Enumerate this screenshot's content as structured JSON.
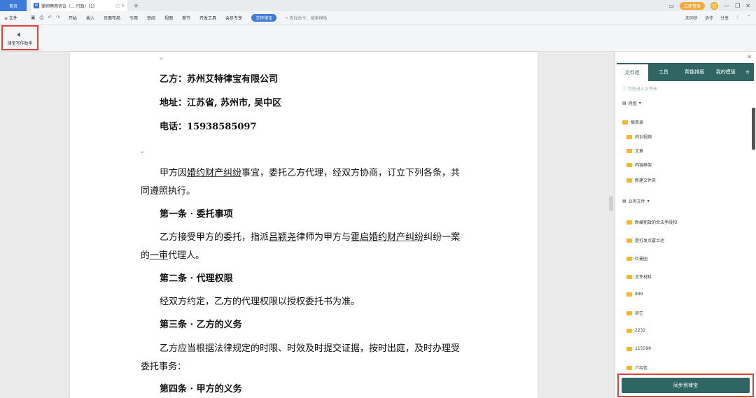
{
  "titlebar": {
    "home_tab": "首页",
    "doc_tab": "律师聘用协议（... 行政）(1)",
    "new_tab": "+",
    "login": "立即登录",
    "min": "—",
    "restore": "❐",
    "close": "✕"
  },
  "menubar": {
    "file": "≡ 文件",
    "items": [
      "开始",
      "插入",
      "页面布局",
      "引用",
      "审阅",
      "视图",
      "章节",
      "开发工具",
      "会员专享"
    ],
    "active": "艾特律宝",
    "search": "查找命令、搜索模板",
    "right": [
      "未同步",
      "协作",
      "分享"
    ]
  },
  "ribbon": {
    "assistant_label": "律宝写作助手"
  },
  "document": {
    "party_b": "乙方：苏州艾特律宝有限公司",
    "address": "地址：江苏省, 苏州市, 吴中区",
    "phone": "电话：15938585097",
    "intro_1a": "甲方因",
    "intro_1b": "婚约财产纠纷",
    "intro_1c": "事宜，委托乙方代理，经双方协商，订立下列各条，共",
    "intro_2": "同遵照执行。",
    "art1_title": "第一条 · 委托事项",
    "art1_1a": "乙方接受甲方的委托，指派",
    "art1_1b": "吕颖尧",
    "art1_1c": "律师为甲方与",
    "art1_1d": "霍启婚约财产纠纷",
    "art1_1e": "纠纷一案",
    "art1_2a": "的",
    "art1_2b": "一审",
    "art1_2c": "代理人。",
    "art2_title": "第二条 · 代理权限",
    "art2_1": "经双方约定，乙方的代理权限以授权委托书为准。",
    "art3_title": "第三条 · 乙方的义务",
    "art3_1": "乙方应当根据法律规定的时限、时效及时提交证据，按时出庭，及时办理受",
    "art3_2": "委托事务：",
    "art4_title": "第四条 · 甲方的义务",
    "mark": "↵"
  },
  "panel": {
    "tabs": [
      "文件柜",
      "工具",
      "帮能排版",
      "我的模版"
    ],
    "menu": "≡",
    "hint": "ⓘ 可拖进入文件夹",
    "netdisk": "网盘",
    "root": "根目录",
    "root_folders": [
      "内训视频",
      "文章",
      "内容框架",
      "新建文件夹"
    ],
    "business": "业务文件",
    "business_folders": [
      "新编宪政的合法手段和",
      "是打发点富士达",
      "杜曼园",
      "文件材料",
      "999",
      "其它",
      "2232",
      "115599",
      "介绍信"
    ],
    "sync_button": "同步到律宝"
  }
}
